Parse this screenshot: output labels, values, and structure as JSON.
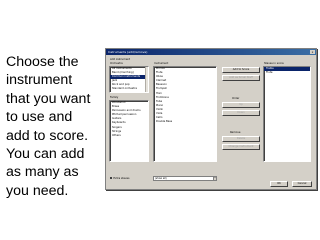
{
  "caption": "Choose the\ninstrument\nthat you want\nto use and\nadd to score.\nYou can add\nas many as\nyou need.",
  "dialog": {
    "title": "Instruments (add/remove)",
    "close_glyph": "x",
    "add_instrument_label": "Add instrument",
    "orchestra_label": "Orchestra",
    "orchestra_items": [
      {
        "label": "All instruments",
        "selected": false
      },
      {
        "label": "Band (marching)",
        "selected": false
      },
      {
        "label": "Common instruments",
        "selected": true
      },
      {
        "label": "Jazz",
        "selected": false
      },
      {
        "label": "Rock and pop",
        "selected": false
      },
      {
        "label": "Standard orchestra",
        "selected": false
      }
    ],
    "family_label": "Family",
    "family_items": [
      {
        "label": "Woodwind",
        "selected": false
      },
      {
        "label": "Brass",
        "selected": false
      },
      {
        "label": "Percussion and drums",
        "selected": false
      },
      {
        "label": "Pitched percussion",
        "selected": false
      },
      {
        "label": "Guitars",
        "selected": false
      },
      {
        "label": "Keyboards",
        "selected": false
      },
      {
        "label": "Singers",
        "selected": false
      },
      {
        "label": "Strings",
        "selected": false
      },
      {
        "label": "Others",
        "selected": false
      }
    ],
    "instrument_label": "Instrument",
    "instrument_items": [
      "Piccolo",
      "Flute",
      "Oboe",
      "Clarinet",
      "Bassoon",
      "Trumpet",
      "Horn",
      "Trombone",
      "Tuba",
      "Piano",
      "Violin",
      "Viola",
      "Cello",
      "Double Bass"
    ],
    "add_to_score_button": "Add to Score",
    "add_as_small_staff_button": "Add as Small Staff",
    "order_label": "Order",
    "up_button": "Up",
    "down_button": "Down",
    "remove_label": "Remove",
    "delete_button": "Delete",
    "staves_label": "Staves in score",
    "staves_items": [
      {
        "label": "Treble",
        "selected": true
      },
      {
        "label": "Flute",
        "selected": false
      }
    ],
    "change_label": "Change instrument",
    "change_select": "(show all)",
    "extra_check_label": "Extra staves",
    "checkbox_checked": false,
    "ok_button": "OK",
    "cancel_button": "Cancel"
  }
}
